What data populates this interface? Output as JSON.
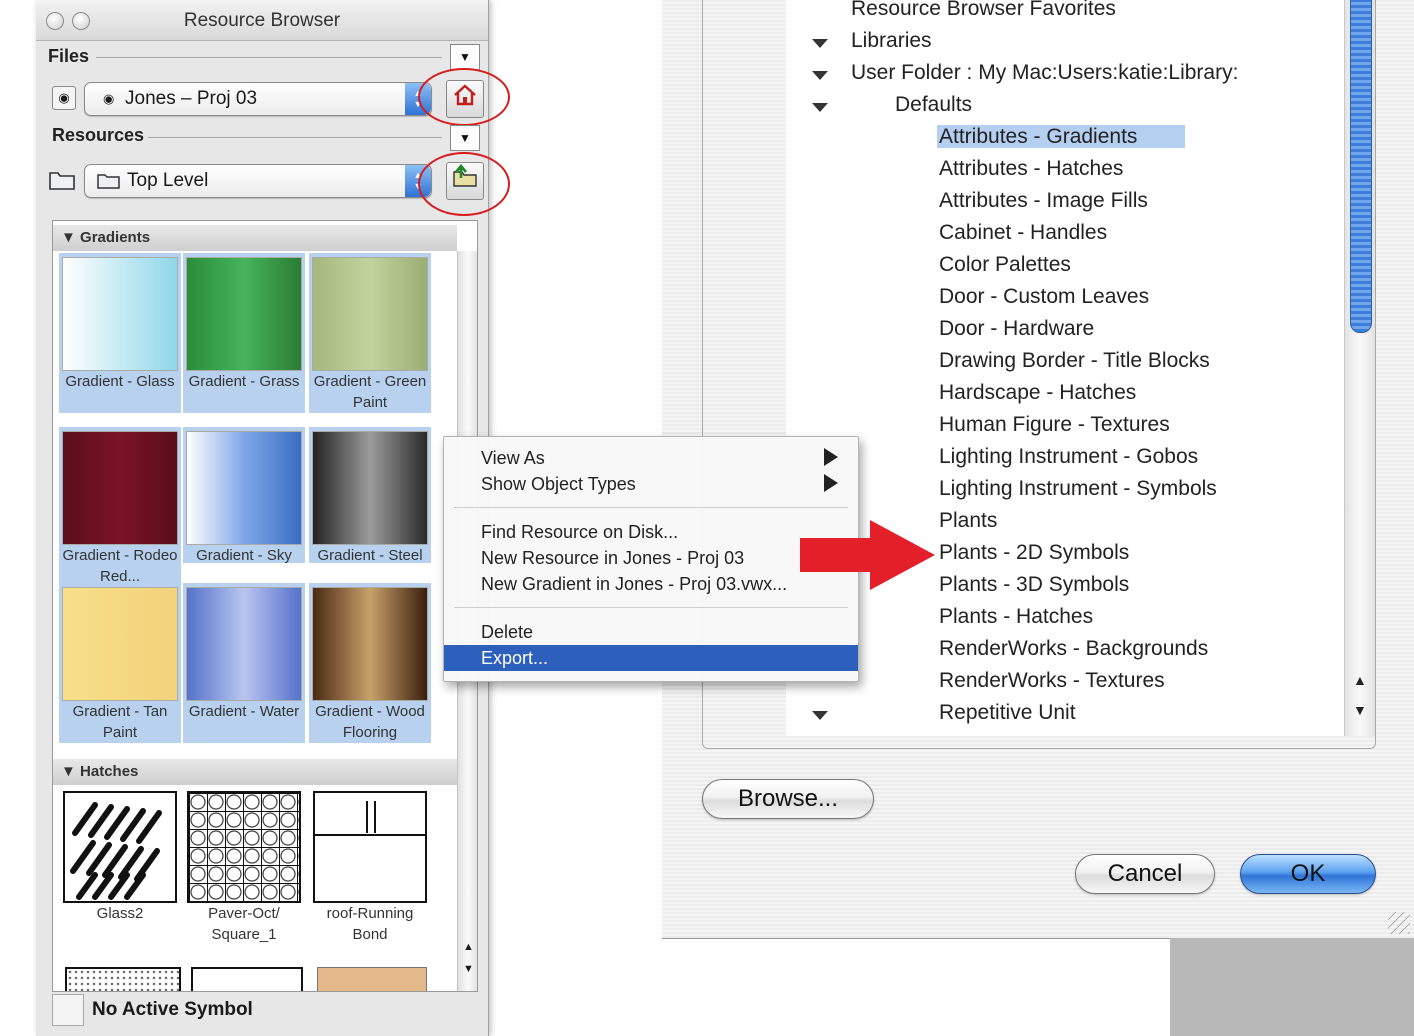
{
  "palette": {
    "title": "Resource Browser",
    "files_label": "Files",
    "files_popup_value": "Jones – Proj 03",
    "resources_label": "Resources",
    "resources_popup_value": "Top Level",
    "groups": {
      "gradients_label": "Gradients",
      "hatches_label": "Hatches"
    },
    "gradient_tiles": [
      {
        "label": "Gradient - Glass",
        "swatch": "glass",
        "selected": true
      },
      {
        "label": "Gradient - Grass",
        "swatch": "grass",
        "selected": true
      },
      {
        "label": "Gradient - Green Paint",
        "swatch": "green-paint",
        "selected": true
      },
      {
        "label": "Gradient - Rodeo Red...",
        "swatch": "rodeo-red",
        "selected": true
      },
      {
        "label": "Gradient - Sky",
        "swatch": "sky",
        "selected": true
      },
      {
        "label": "Gradient - Steel",
        "swatch": "steel",
        "selected": true
      },
      {
        "label": "Gradient - Tan Paint",
        "swatch": "tan",
        "selected": true
      },
      {
        "label": "Gradient - Water",
        "swatch": "water",
        "selected": true
      },
      {
        "label": "Gradient - Wood Flooring",
        "swatch": "wood",
        "selected": true
      }
    ],
    "hatch_tiles": [
      {
        "label": "Glass2"
      },
      {
        "label": "Paver-Oct/ Square_1"
      },
      {
        "label": "roof-Running Bond"
      }
    ],
    "status": "No Active Symbol",
    "icons": {
      "home": "house-icon",
      "up": "folder-up-icon",
      "file": "document-icon",
      "folder": "folder-icon"
    },
    "colors": {
      "annotation_red": "#d81c1c",
      "selection": "#b7d1ef"
    }
  },
  "context_menu": {
    "items": [
      {
        "label": "View As",
        "submenu": true
      },
      {
        "label": "Show Object Types",
        "submenu": true
      },
      {
        "label": "Find Resource on Disk..."
      },
      {
        "label": "New Resource in Jones - Proj 03"
      },
      {
        "label": "New Gradient in Jones - Proj 03.vwx..."
      },
      {
        "label": "Delete"
      },
      {
        "label": "Export...",
        "highlighted": true
      }
    ],
    "highlight_color": "#2d60bd"
  },
  "dialog": {
    "tree": [
      {
        "label": "Resource Browser Favorites",
        "level": 0,
        "expander": false
      },
      {
        "label": "Libraries",
        "level": 0,
        "expander": true
      },
      {
        "label": "User Folder : My Mac:Users:katie:Library:",
        "level": 1,
        "expander": true
      },
      {
        "label": "Defaults",
        "level": 2,
        "expander": true
      },
      {
        "label": "Attributes - Gradients",
        "level": 3,
        "selected": true
      },
      {
        "label": "Attributes - Hatches",
        "level": 3
      },
      {
        "label": "Attributes - Image Fills",
        "level": 3
      },
      {
        "label": "Cabinet - Handles",
        "level": 3
      },
      {
        "label": "Color Palettes",
        "level": 3
      },
      {
        "label": "Door - Custom Leaves",
        "level": 3
      },
      {
        "label": "Door - Hardware",
        "level": 3
      },
      {
        "label": "Drawing Border - Title Blocks",
        "level": 3
      },
      {
        "label": "Hardscape - Hatches",
        "level": 3
      },
      {
        "label": "Human Figure - Textures",
        "level": 3
      },
      {
        "label": "Lighting Instrument - Gobos",
        "level": 3
      },
      {
        "label": "Lighting Instrument - Symbols",
        "level": 3
      },
      {
        "label": "Plants",
        "level": 3
      },
      {
        "label": "Plants - 2D Symbols",
        "level": 3,
        "pointed": true
      },
      {
        "label": "Plants - 3D Symbols",
        "level": 3
      },
      {
        "label": "Plants - Hatches",
        "level": 3
      },
      {
        "label": "RenderWorks - Backgrounds",
        "level": 3
      },
      {
        "label": "RenderWorks - Textures",
        "level": 3
      },
      {
        "label": "Repetitive Unit",
        "level": 3,
        "expander_at_level": 0
      }
    ],
    "browse_label": "Browse...",
    "cancel_label": "Cancel",
    "ok_label": "OK",
    "colors": {
      "selection": "#b5cff0",
      "pointer_arrow": "#e3202a"
    }
  }
}
